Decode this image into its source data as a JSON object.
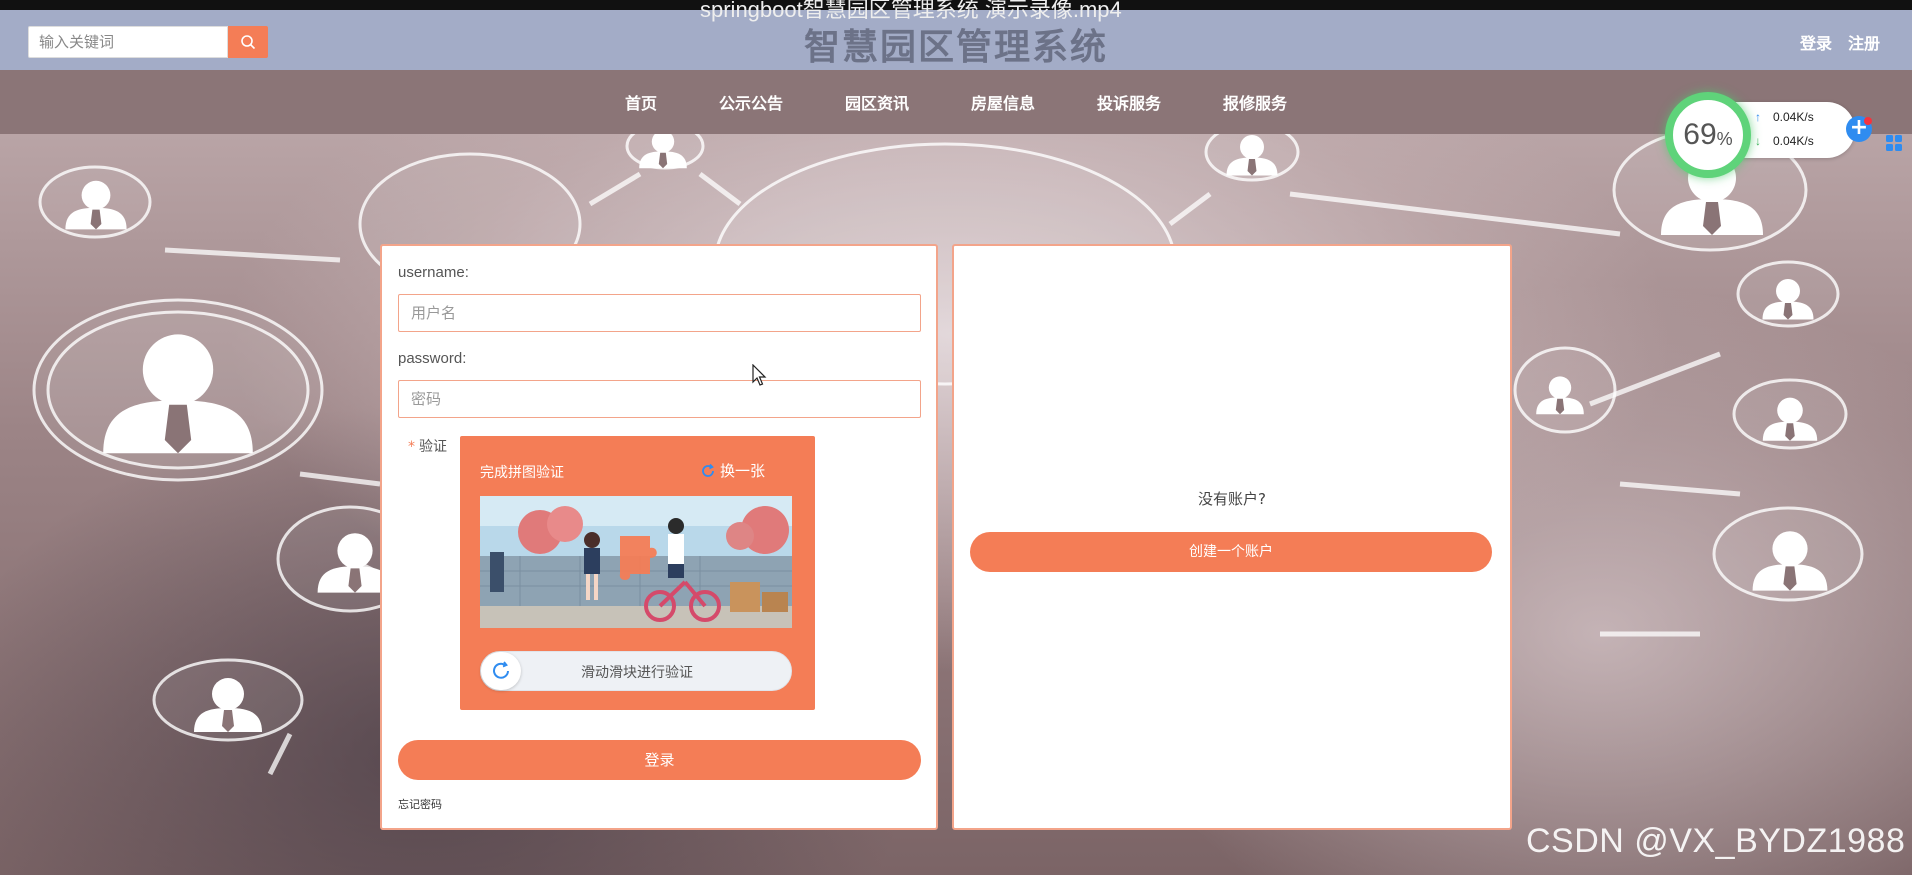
{
  "video": {
    "title": "springboot智慧园区管理系统 演示录像.mp4"
  },
  "header": {
    "search_placeholder": "输入关键词",
    "site_title": "智慧园区管理系统",
    "login_link": "登录",
    "register_link": "注册"
  },
  "nav": {
    "items": [
      "首页",
      "公示公告",
      "园区资讯",
      "房屋信息",
      "投诉服务",
      "报修服务"
    ]
  },
  "speed_widget": {
    "percent": "69",
    "percent_unit": "%",
    "upload": "0.04K/s",
    "download": "0.04K/s"
  },
  "login": {
    "username_label": "username:",
    "username_placeholder": "用户名",
    "password_label": "password:",
    "password_placeholder": "密码",
    "verify_star": "*",
    "verify_label": "验证",
    "captcha_title": "完成拼图验证",
    "captcha_refresh": "换一张",
    "slider_text": "滑动滑块进行验证",
    "login_button": "登录",
    "forgot_password": "忘记密码"
  },
  "register": {
    "no_account": "没有账户?",
    "create_button": "创建一个账户"
  },
  "watermark": "CSDN @VX_BYDZ1988",
  "colors": {
    "accent": "#f47d56",
    "header": "#a3acc7",
    "nav": "#8c7678",
    "panel_border": "#f3a48a"
  }
}
